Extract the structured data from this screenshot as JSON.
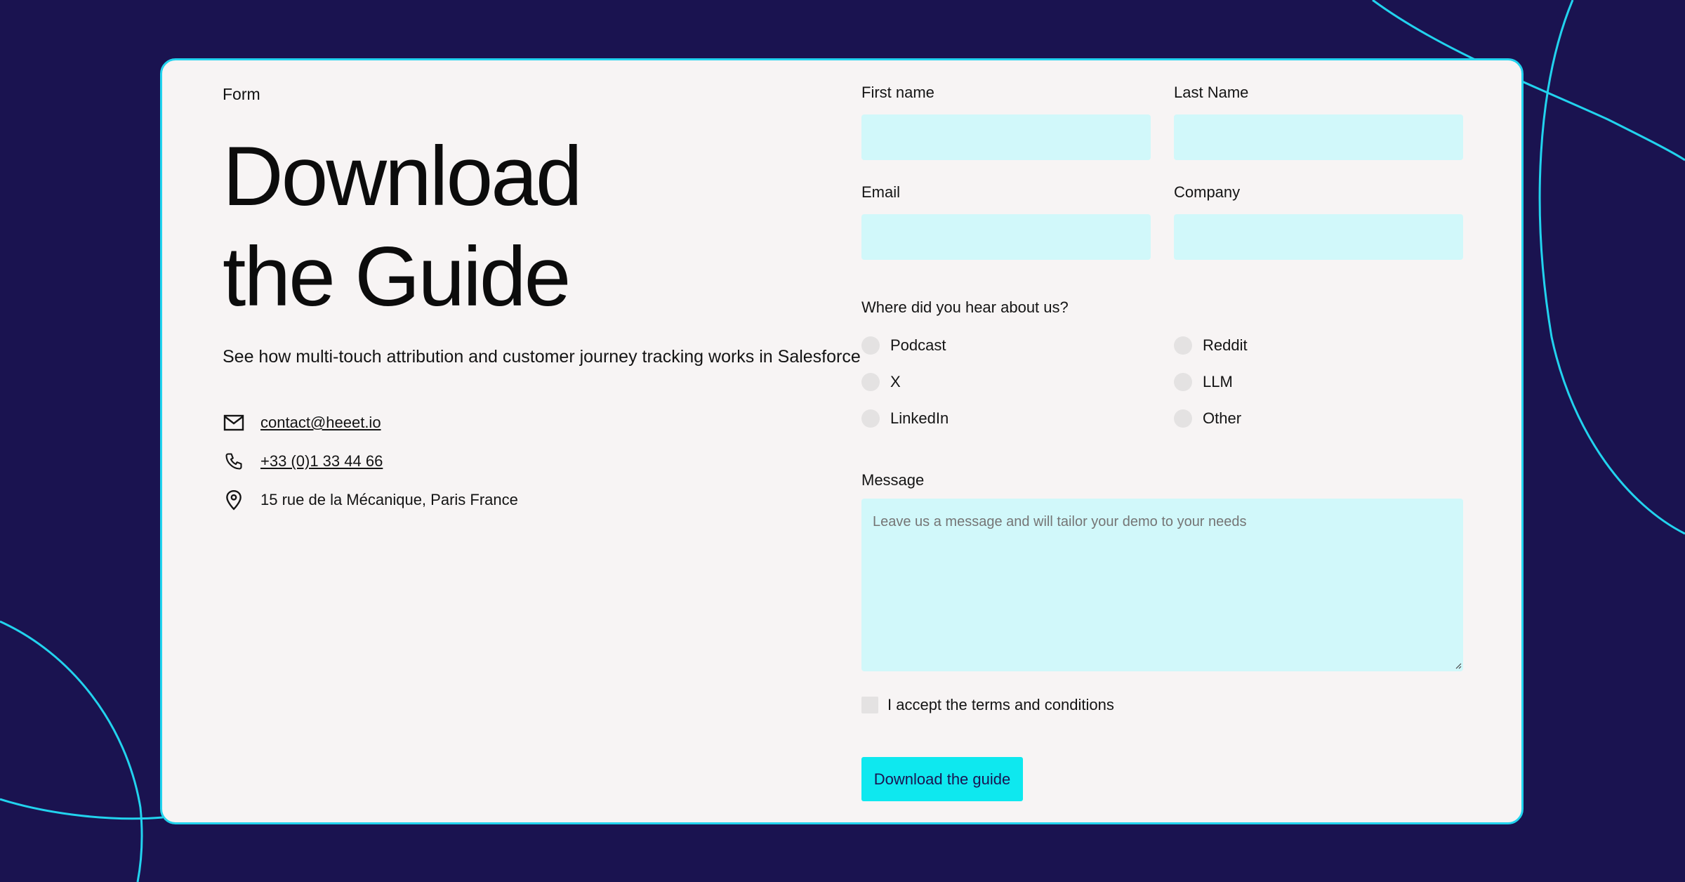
{
  "colors": {
    "background": "#1a1350",
    "card": "#f7f4f4",
    "accent": "#22d3ee",
    "input_fill": "#d1f8fa",
    "button": "#0ee8ef"
  },
  "left": {
    "eyebrow": "Form",
    "title_line1": "Download",
    "title_line2": "the Guide",
    "subtitle": "See how  multi-touch attribution and customer journey tracking works in Salesforce",
    "contacts": {
      "email": {
        "icon": "mail-icon",
        "text": "contact@heeet.io"
      },
      "phone": {
        "icon": "phone-icon",
        "text": "+33 (0)1 33 44 66"
      },
      "address": {
        "icon": "map-pin-icon",
        "text": "15 rue de la Mécanique, Paris France"
      }
    }
  },
  "form": {
    "first_name": {
      "label": "First name",
      "value": ""
    },
    "last_name": {
      "label": "Last Name",
      "value": ""
    },
    "email": {
      "label": "Email",
      "value": ""
    },
    "company": {
      "label": "Company",
      "value": ""
    },
    "source": {
      "label": "Where did you hear about us?",
      "options": [
        "Podcast",
        "Reddit",
        "X",
        "LLM",
        "LinkedIn",
        "Other"
      ]
    },
    "message": {
      "label": "Message",
      "placeholder": "Leave us a message and will tailor your demo to your needs"
    },
    "terms_label": "I accept the terms and conditions",
    "submit_label": "Download the guide"
  }
}
